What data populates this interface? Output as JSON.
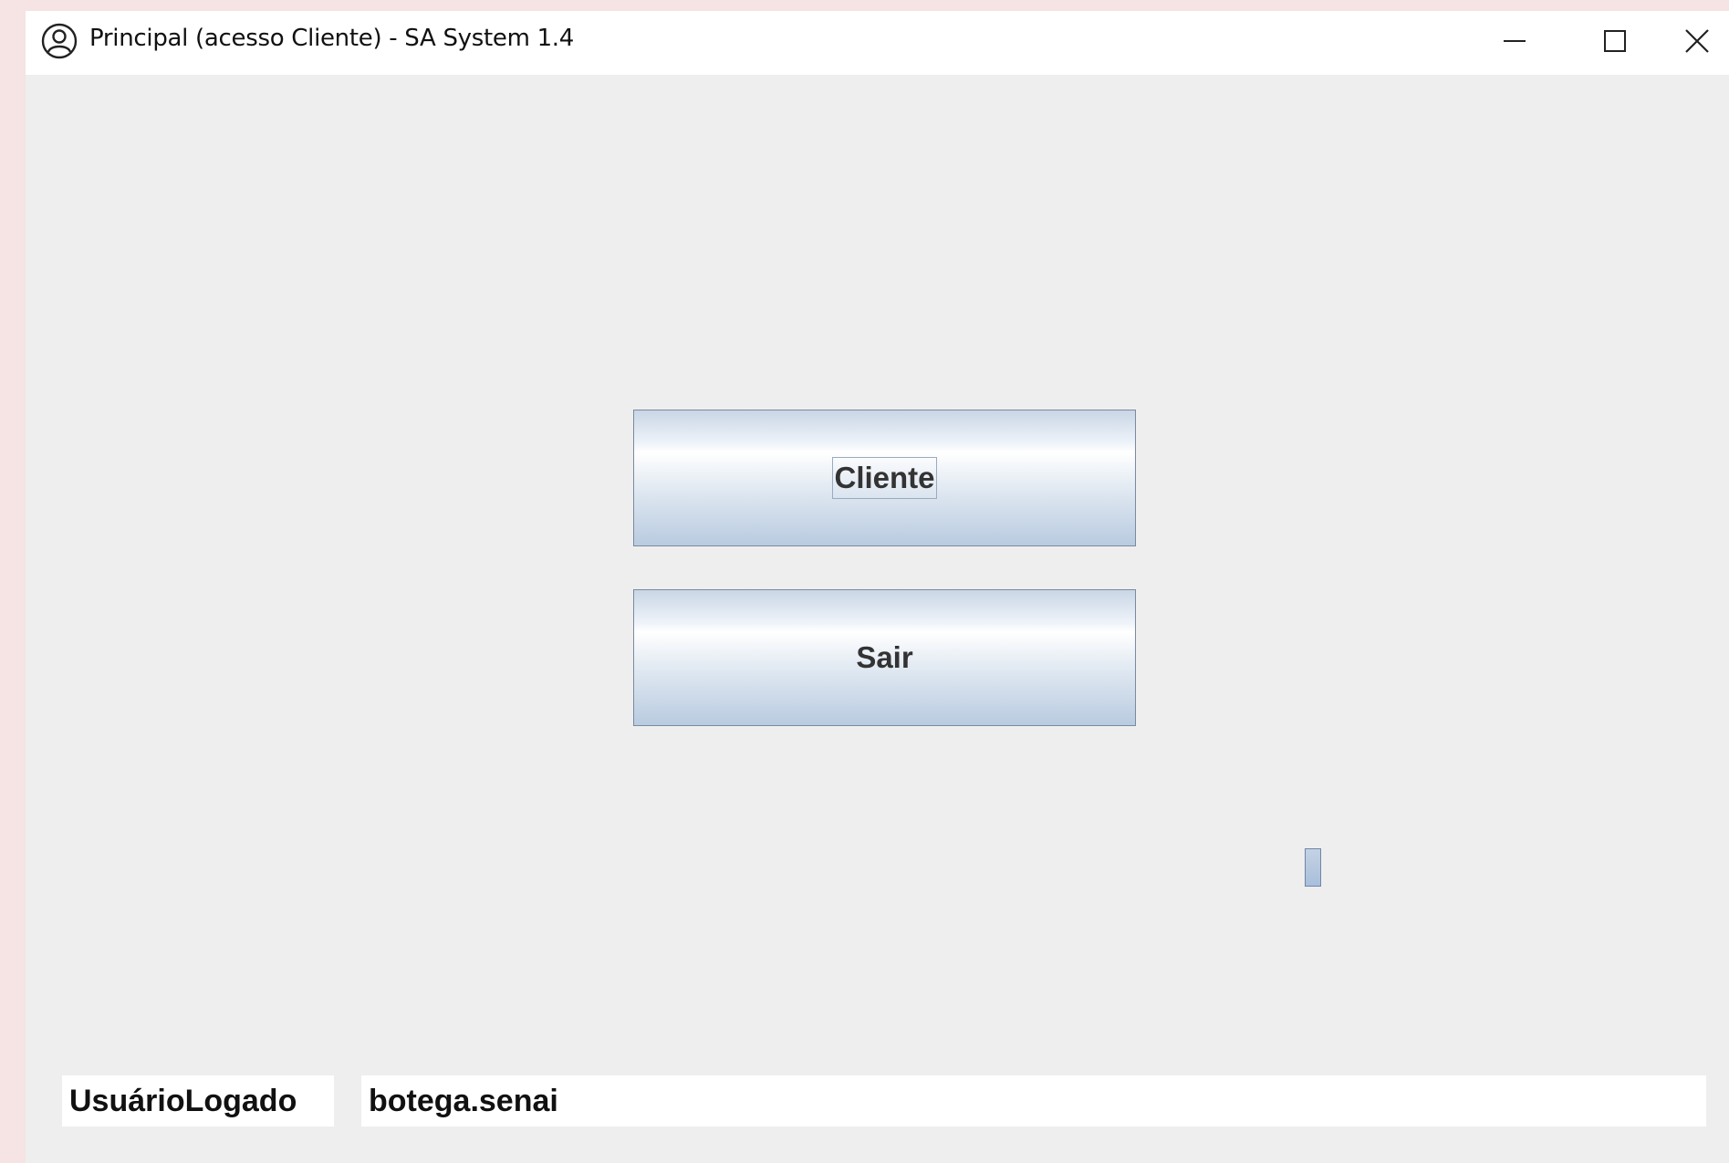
{
  "window": {
    "title": "Principal (acesso Cliente) - SA System 1.4",
    "app_icon": "user-circle-icon",
    "controls": {
      "minimize_icon": "minimize-icon",
      "maximize_icon": "maximize-icon",
      "close_icon": "close-icon"
    }
  },
  "main": {
    "cliente_label": "Cliente",
    "sair_label": "Sair"
  },
  "status": {
    "user_label": "UsuárioLogado",
    "user_value": "botega.senai"
  },
  "colors": {
    "background": "#f6e3e3",
    "window_body": "#eeeeee",
    "button_gradient_top": "#eef3f9",
    "button_gradient_bottom": "#b9cbe0",
    "button_border": "#7a8aa0"
  }
}
